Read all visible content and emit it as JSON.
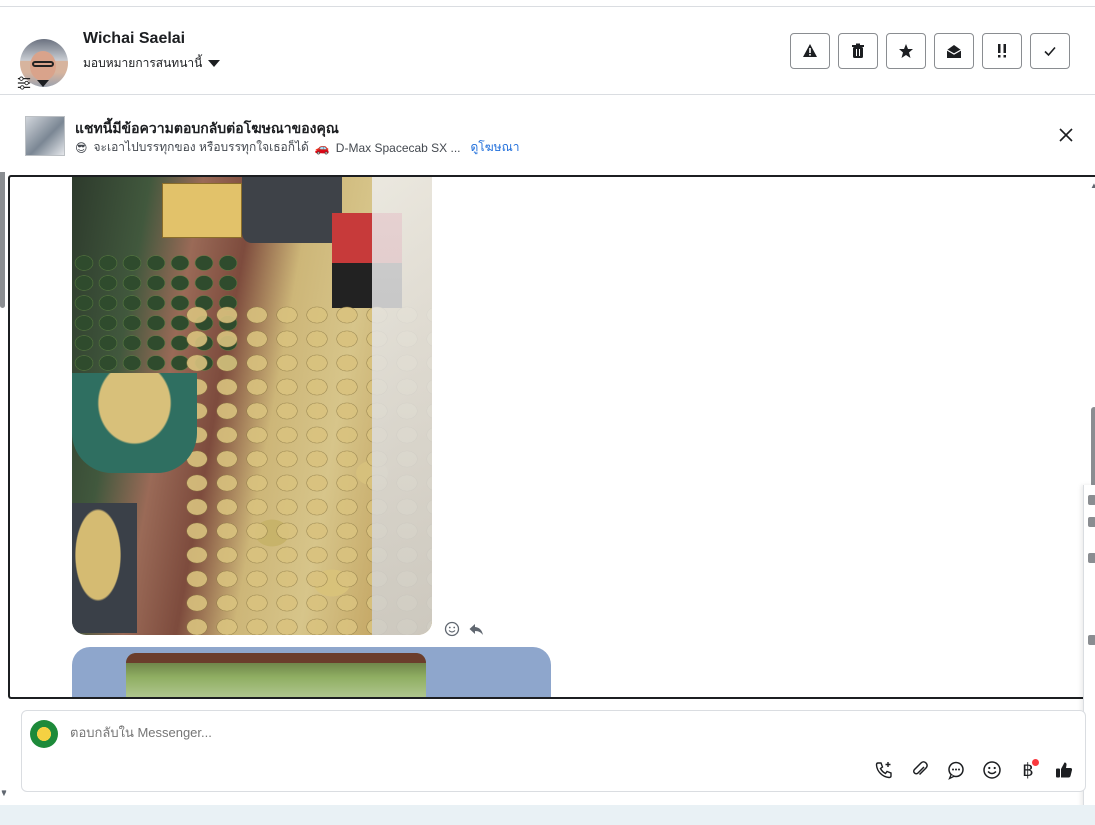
{
  "header": {
    "user_name": "Wichai Saelai",
    "assign_label": "มอบหมายการสนทนานี้",
    "actions": [
      {
        "name": "report-spam-button",
        "icon": "warning-icon"
      },
      {
        "name": "delete-button",
        "icon": "trash-icon"
      },
      {
        "name": "star-button",
        "icon": "star-icon"
      },
      {
        "name": "mark-unread-button",
        "icon": "envelope-open-icon"
      },
      {
        "name": "follow-up-button",
        "icon": "exclamation-icon"
      },
      {
        "name": "mark-done-button",
        "icon": "check-icon"
      }
    ]
  },
  "ad_banner": {
    "title": "แชทนี้มีข้อความตอบกลับต่อโฆษณาของคุณ",
    "emoji_1": "😎",
    "subtitle": "จะเอาไปบรรทุกของ หรือบรรทุกใจเธอก็ได้",
    "emoji_2": "🚗",
    "model": "D-Max Spacecab SX ...",
    "link_label": "ดูโฆษณา"
  },
  "messages": [
    {
      "type": "image",
      "description_icon": "melons-photo"
    },
    {
      "type": "image",
      "description_icon": "garden-photo"
    }
  ],
  "composer": {
    "placeholder": "ตอบกลับใน Messenger...",
    "currency_symbol": "฿",
    "tools": [
      "phone-plus-icon",
      "paperclip-icon",
      "chat-bubble-icon",
      "smiley-icon",
      "baht-icon",
      "thumbs-up-icon"
    ]
  },
  "colors": {
    "accent_blue": "#216fdb",
    "bubble_blue": "#8ea6cc",
    "notification_red": "#fa383e"
  }
}
